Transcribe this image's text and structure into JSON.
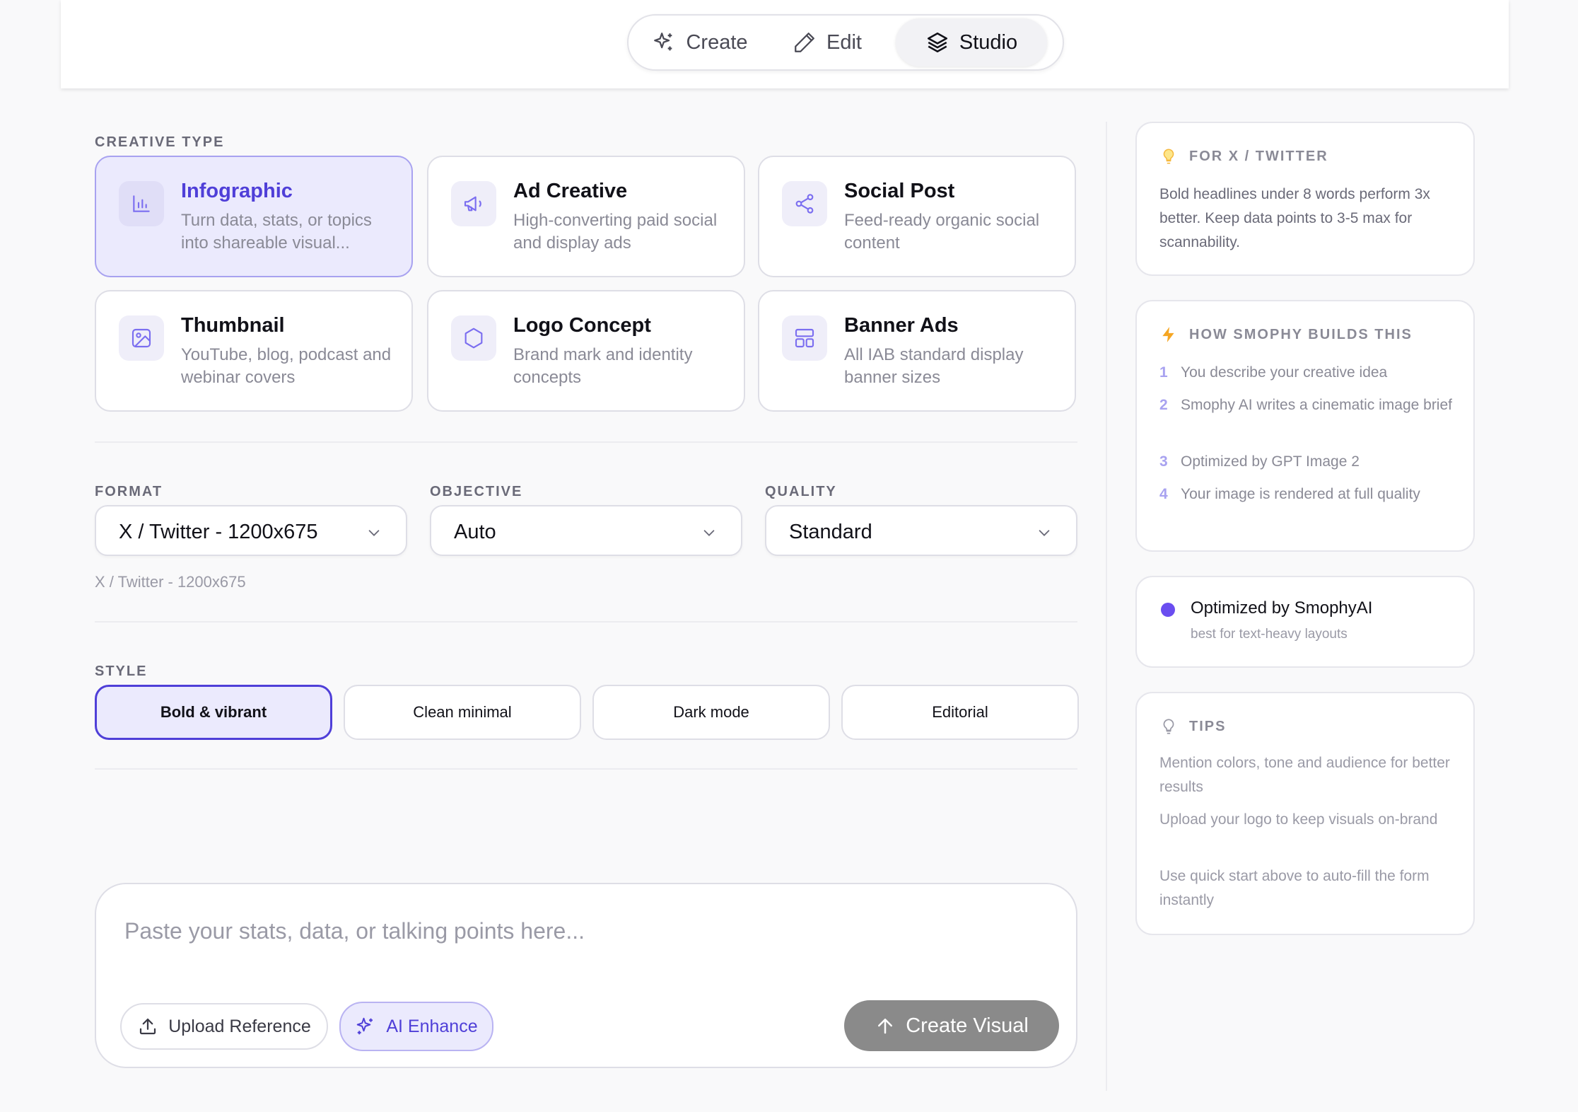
{
  "mode_tabs": [
    {
      "label": "Create",
      "icon": "sparkles-icon"
    },
    {
      "label": "Edit",
      "icon": "pencil-icon"
    },
    {
      "label": "Studio",
      "icon": "layers-icon",
      "active": true
    }
  ],
  "creative_type": {
    "label": "CREATIVE TYPE",
    "cards": [
      {
        "title": "Infographic",
        "desc": "Turn data, stats, or topics into shareable visual...",
        "icon": "bar-chart-icon",
        "selected": true
      },
      {
        "title": "Ad Creative",
        "desc": "High-converting paid social and display ads",
        "icon": "megaphone-icon"
      },
      {
        "title": "Social Post",
        "desc": "Feed-ready organic social content",
        "icon": "share-icon"
      },
      {
        "title": "Thumbnail",
        "desc": "YouTube, blog, podcast and webinar covers",
        "icon": "image-icon"
      },
      {
        "title": "Logo Concept",
        "desc": "Brand mark and identity concepts",
        "icon": "hexagon-icon"
      },
      {
        "title": "Banner Ads",
        "desc": "All IAB standard display banner sizes",
        "icon": "layout-icon"
      }
    ]
  },
  "format": {
    "label": "FORMAT",
    "value": "X / Twitter - 1200x675",
    "hint": "X / Twitter - 1200x675"
  },
  "objective": {
    "label": "OBJECTIVE",
    "value": "Auto"
  },
  "quality": {
    "label": "QUALITY",
    "value": "Standard"
  },
  "style": {
    "label": "STYLE",
    "options": [
      "Bold & vibrant",
      "Clean minimal",
      "Dark mode",
      "Editorial"
    ],
    "selected": "Bold & vibrant"
  },
  "prompt": {
    "placeholder": "Paste your stats, data, or talking points here...",
    "upload_label": "Upload Reference",
    "enhance_label": "AI Enhance",
    "create_label": "Create Visual"
  },
  "sidebar": {
    "twitter_tip": {
      "heading": "FOR X / TWITTER",
      "text": "Bold headlines under 8 words perform 3x better. Keep data points to 3-5 max for scannability."
    },
    "how_it_works": {
      "heading": "HOW SMOPHY BUILDS THIS",
      "steps": [
        {
          "num": "1",
          "text": "You describe your creative idea"
        },
        {
          "num": "2",
          "text": "Smophy AI writes a cinematic image brief"
        },
        {
          "num": "3",
          "text": "Optimized by GPT Image 2"
        },
        {
          "num": "4",
          "text": "Your image is rendered at full quality"
        }
      ]
    },
    "optimized": {
      "title": "Optimized by SmophyAI",
      "subtitle": "best for text-heavy layouts"
    },
    "tips": {
      "heading": "TIPS",
      "items": [
        "Mention colors, tone and audience for better results",
        "Upload your logo to keep visuals on-brand",
        "Use quick start above to auto-fill the form instantly"
      ]
    }
  },
  "colors": {
    "accent": "#4f3fd8",
    "accent_bg": "#ebeafd",
    "create_button": "#8a8a8a",
    "bolt": "#f5a623"
  }
}
